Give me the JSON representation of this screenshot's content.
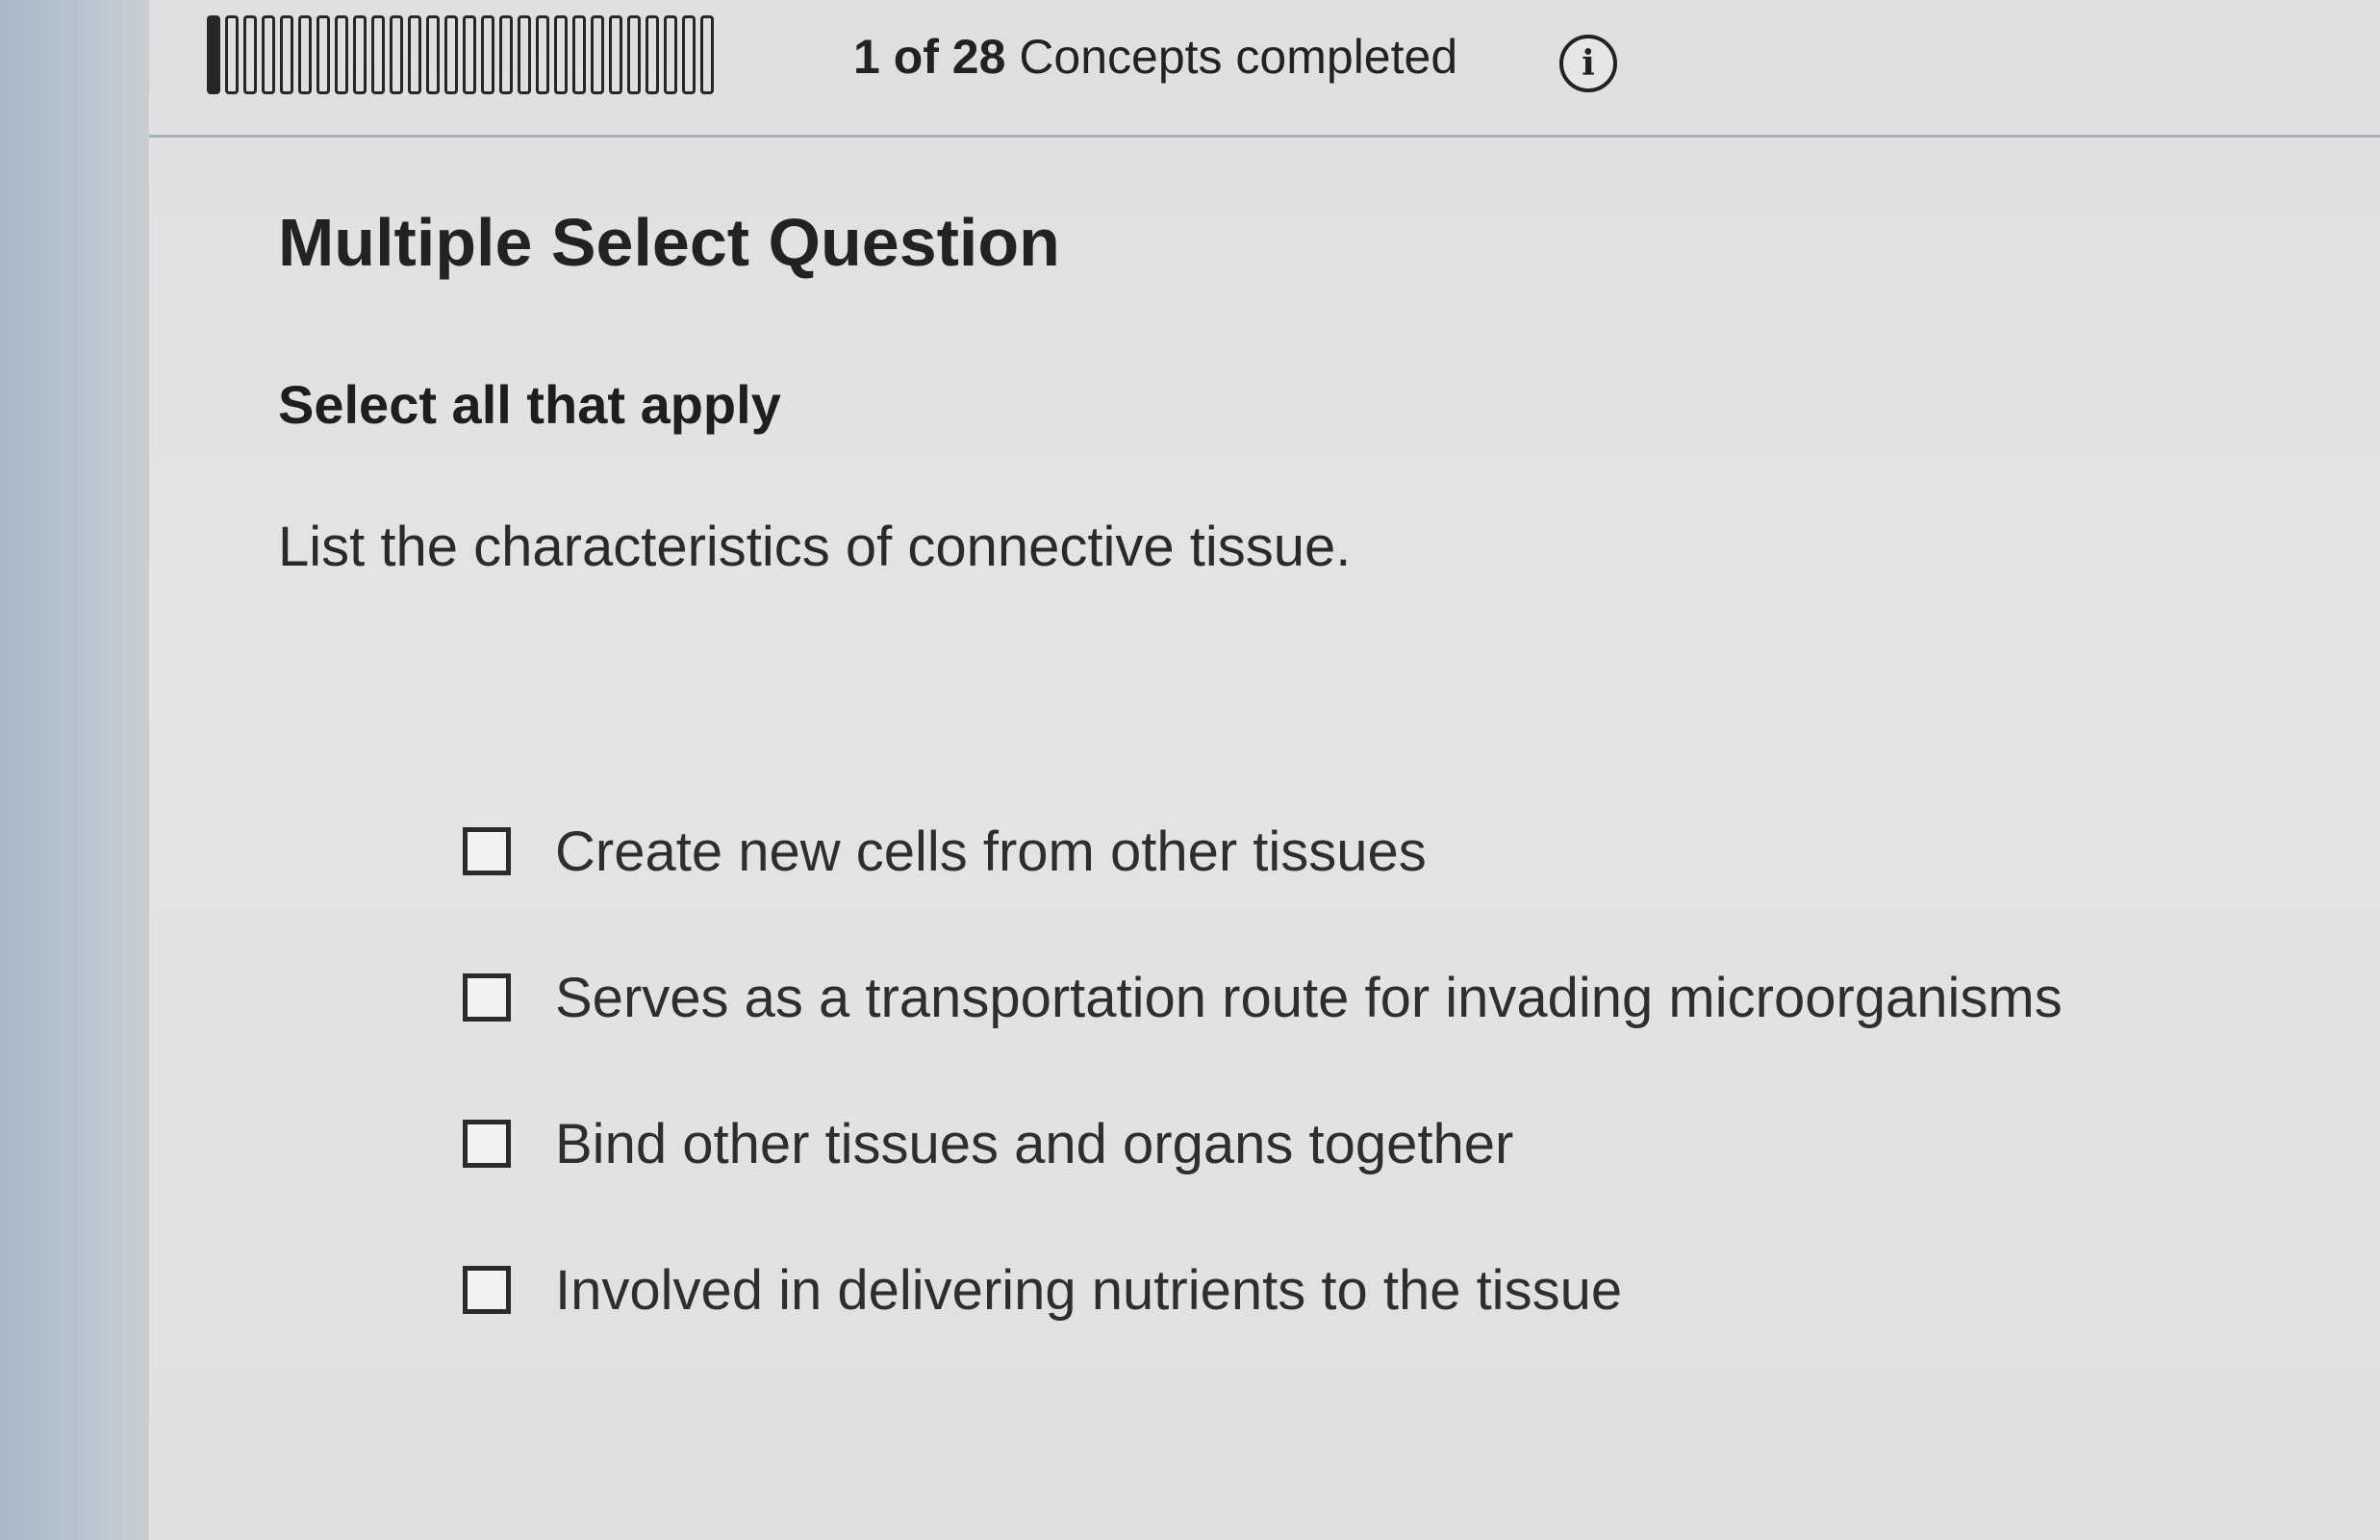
{
  "progress": {
    "completed": 1,
    "total": 28,
    "count_text": "1 of 28",
    "suffix_text": "Concepts completed",
    "info_icon": "info-icon",
    "info_glyph": "i"
  },
  "question": {
    "type_title": "Multiple Select Question",
    "instruction": "Select all that apply",
    "prompt": "List the characteristics of connective tissue.",
    "options": [
      {
        "label": "Create new cells from other tissues",
        "checked": false
      },
      {
        "label": "Serves as a transportation route for invading microorganisms",
        "checked": false
      },
      {
        "label": "Bind other tissues and organs together",
        "checked": false
      },
      {
        "label": "Involved in delivering nutrients to the tissue",
        "checked": false
      }
    ]
  }
}
